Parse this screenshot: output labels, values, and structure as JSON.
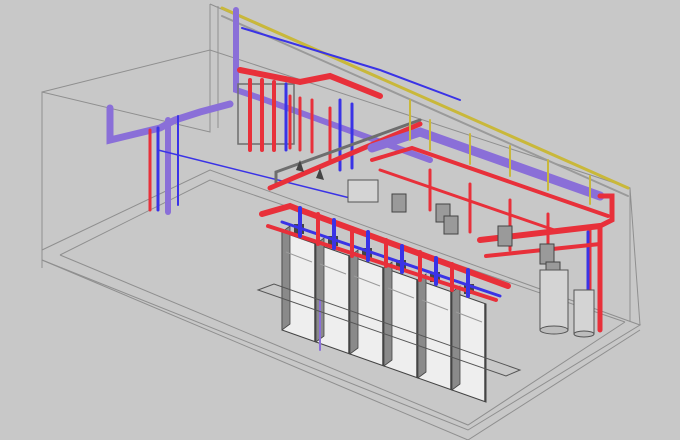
{
  "colors": {
    "background": "#c8c8c8",
    "room_lines": "#8f8f8f",
    "supply_red": "#e8303a",
    "return_blue": "#3a33e6",
    "purple_pipe": "#8a6fd8",
    "gas_yellow": "#c9b83a",
    "equipment_gray": "#6e6e6e",
    "boiler_face": "#eeeeee",
    "boiler_shadow": "#8a8a8a",
    "pump_dark": "#444444"
  },
  "equipment": {
    "boilers": {
      "count": 6
    },
    "pumps": {
      "count": 8
    },
    "tanks": {
      "count": 2
    }
  }
}
